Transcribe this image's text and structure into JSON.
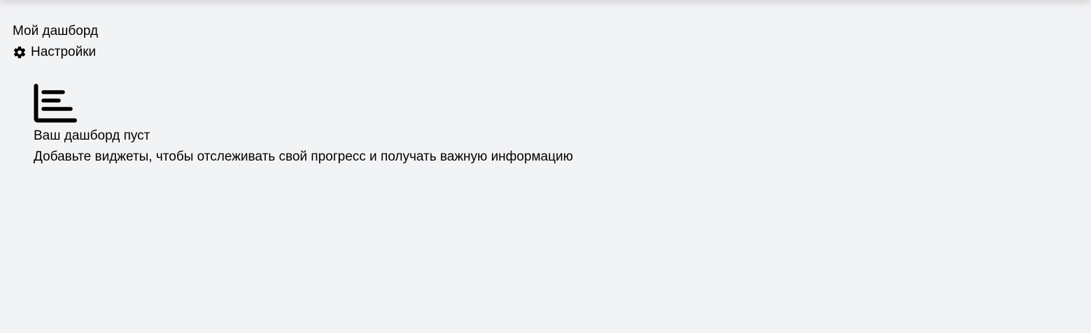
{
  "dashboard": {
    "title": "Мой дашборд",
    "settings_label": "Настройки",
    "settings_icon": "gear-icon"
  },
  "empty_state": {
    "icon": "bar-chart-icon",
    "title": "Ваш дашборд пуст",
    "description": "Добавьте виджеты, чтобы отслеживать свой прогресс и получать важную информацию"
  }
}
